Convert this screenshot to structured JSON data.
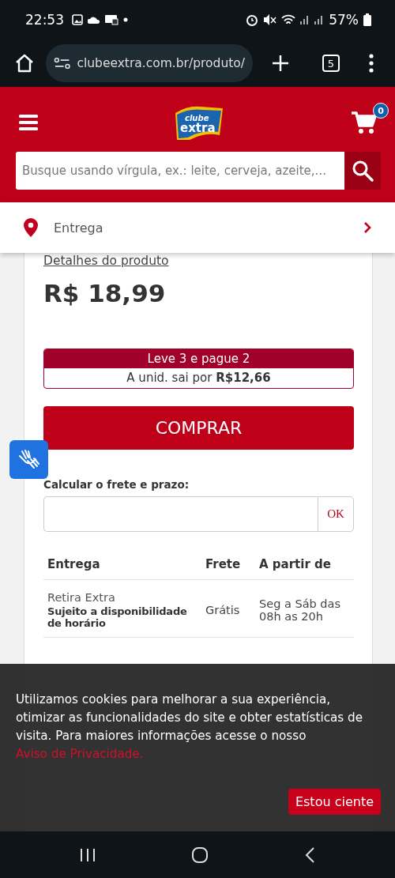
{
  "status_bar": {
    "time": "22:53",
    "battery": "57%"
  },
  "browser": {
    "url": "clubeextra.com.br/produto/",
    "tab_count": "5"
  },
  "header": {
    "logo": {
      "line1": "clube",
      "line2": "extra"
    },
    "cart_count": "0",
    "search": {
      "placeholder": "Busque usando vírgula, ex.: leite, cerveja, azeite,..."
    }
  },
  "location": {
    "label": "Entrega"
  },
  "product": {
    "details_link": "Detalhes do produto",
    "price": "R$ 18,99",
    "promo": {
      "title": "Leve 3 e pague 2",
      "unit_text": "A unid. sai por **R$12,66**"
    },
    "buy_button": "COMPRAR"
  },
  "shipping": {
    "label": "Calcular o frete e prazo:",
    "button": "OK",
    "columns": [
      "Entrega",
      "Frete",
      "A partir de"
    ],
    "rows": [
      {
        "type": "Retira Extra",
        "note": "Sujeito a disponibilidade de horário",
        "price": "Grátis",
        "schedule": "Seg a Sáb das 08h as 20h"
      }
    ]
  },
  "cookie_banner": {
    "text": "Utilizamos cookies para melhorar a sua experiência, otimizar as funcionalidades do site e obter estatísticas de visita. Para maiores informações acesse o nosso ",
    "link": "Aviso de Privacidade.",
    "button": "Estou ciente"
  }
}
